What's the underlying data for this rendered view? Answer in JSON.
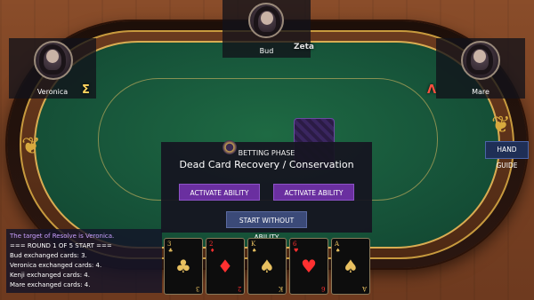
{
  "players": {
    "top": {
      "name": "Bud"
    },
    "left": {
      "name": "Veronica"
    },
    "right": {
      "name": "Mare"
    }
  },
  "emblems": {
    "top": "Zeta",
    "left": "Σ",
    "right": "Λ"
  },
  "panel": {
    "phase": "BETTING PHASE",
    "title": "Dead Card Recovery / Conservation",
    "ability_button_1": "ACTIVATE ABILITY",
    "ability_button_2": "ACTIVATE ABILITY",
    "start_button": "START WITHOUT ABILITY"
  },
  "hand_guide_label": "HAND GUIDE",
  "log": [
    {
      "text": "The target of Resolve is Veronica.",
      "color": "#c9a0ff"
    },
    {
      "text": "=== ROUND 1 OF 5 START ===",
      "color": "#ffffff"
    },
    {
      "text": "Bud exchanged cards: 3.",
      "color": "#ffffff"
    },
    {
      "text": "Veronica exchanged cards: 4.",
      "color": "#ffffff"
    },
    {
      "text": "Kenji exchanged cards: 4.",
      "color": "#ffffff"
    },
    {
      "text": "Mare exchanged cards: 4.",
      "color": "#ffffff"
    }
  ],
  "hand": [
    {
      "rank": "3",
      "suit": "♣",
      "color": "#e8c060"
    },
    {
      "rank": "2",
      "suit": "♦",
      "color": "#ff3030"
    },
    {
      "rank": "K",
      "suit": "♠",
      "color": "#e8c060"
    },
    {
      "rank": "6",
      "suit": "♥",
      "color": "#ff3030"
    },
    {
      "rank": "A",
      "suit": "♠",
      "color": "#e8c060"
    }
  ],
  "colors": {
    "accent_purple": "#6a2fa0",
    "accent_blue": "#3b4a78",
    "felt": "#17553a",
    "gold": "#d9ac52"
  }
}
